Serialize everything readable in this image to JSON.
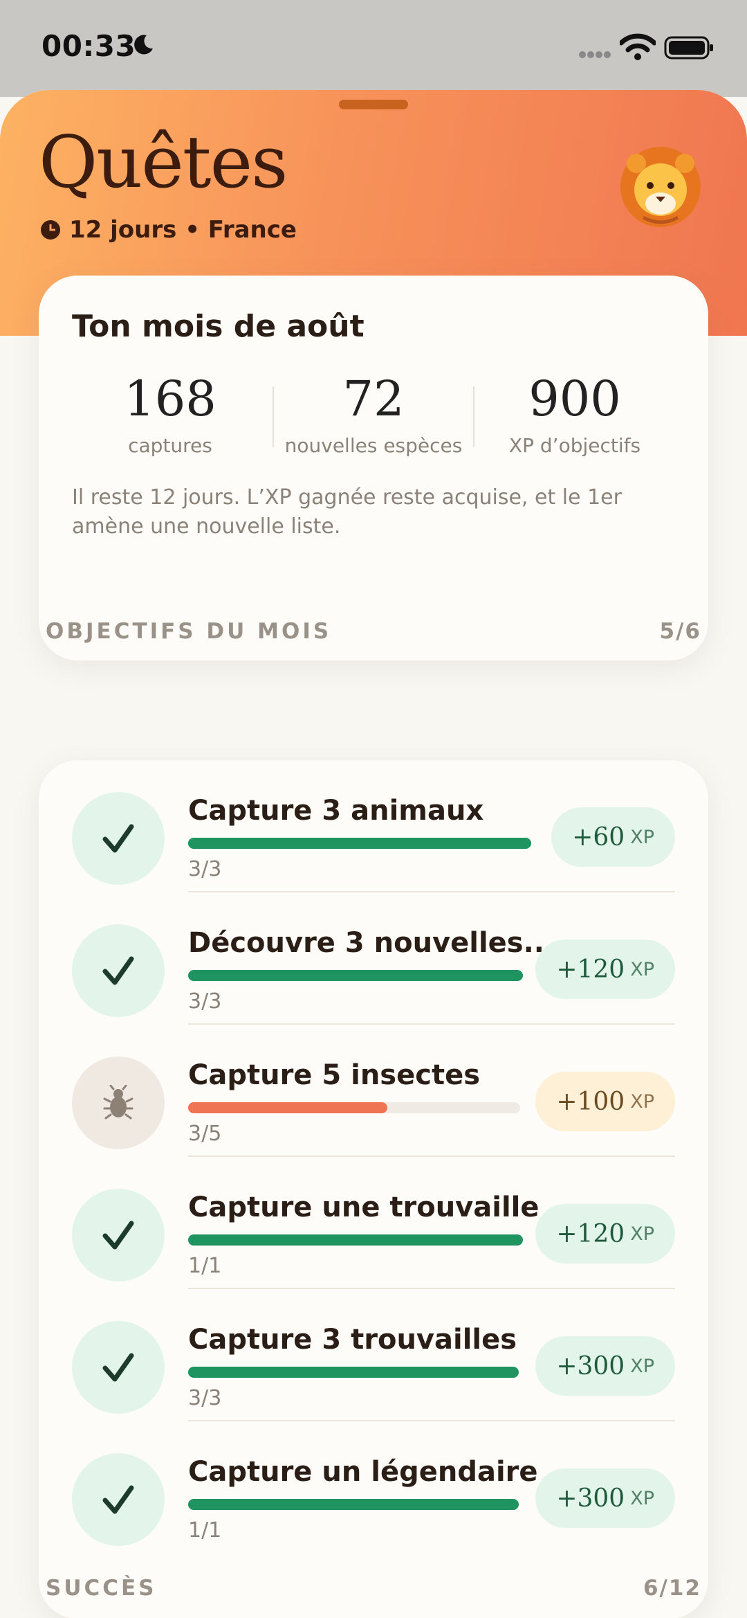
{
  "status_bar": {
    "time": "00:33"
  },
  "header": {
    "title": "Quêtes",
    "subtitle": "12 jours • France",
    "avatar_icon": "lion-avatar-icon"
  },
  "summary": {
    "title": "Ton mois de août",
    "stats": [
      {
        "value": "168",
        "label": "captures"
      },
      {
        "value": "72",
        "label": "nouvelles espèces"
      },
      {
        "value": "900",
        "label": "XP d’objectifs"
      }
    ],
    "note": "Il reste 12 jours. L’XP gagnée reste acquise, et le 1er amène une nouvelle liste."
  },
  "objectives": {
    "heading": "OBJECTIFS DU MOIS",
    "count": "5/6",
    "items": [
      {
        "title": "Capture 3 animaux",
        "progress": "3/3",
        "fraction": 1.0,
        "xp": "+60",
        "unit": "XP",
        "done": true
      },
      {
        "title": "Découvre 3 nouvelles...",
        "progress": "3/3",
        "fraction": 1.0,
        "xp": "+120",
        "unit": "XP",
        "done": true
      },
      {
        "title": "Capture 5 insectes",
        "progress": "3/5",
        "fraction": 0.6,
        "xp": "+100",
        "unit": "XP",
        "done": false,
        "icon": "bug-icon"
      },
      {
        "title": "Capture une trouvaille",
        "progress": "1/1",
        "fraction": 1.0,
        "xp": "+120",
        "unit": "XP",
        "done": true
      },
      {
        "title": "Capture 3 trouvailles",
        "progress": "3/3",
        "fraction": 1.0,
        "xp": "+300",
        "unit": "XP",
        "done": true
      },
      {
        "title": "Capture un légendaire",
        "progress": "1/1",
        "fraction": 1.0,
        "xp": "+300",
        "unit": "XP",
        "done": true
      }
    ]
  },
  "achievements": {
    "heading": "SUCCÈS",
    "count": "6/12"
  },
  "colors": {
    "done_fill": "#1f9360",
    "todo_fill": "#ee7454",
    "hero_start": "#fdb263",
    "hero_end": "#f07650"
  }
}
